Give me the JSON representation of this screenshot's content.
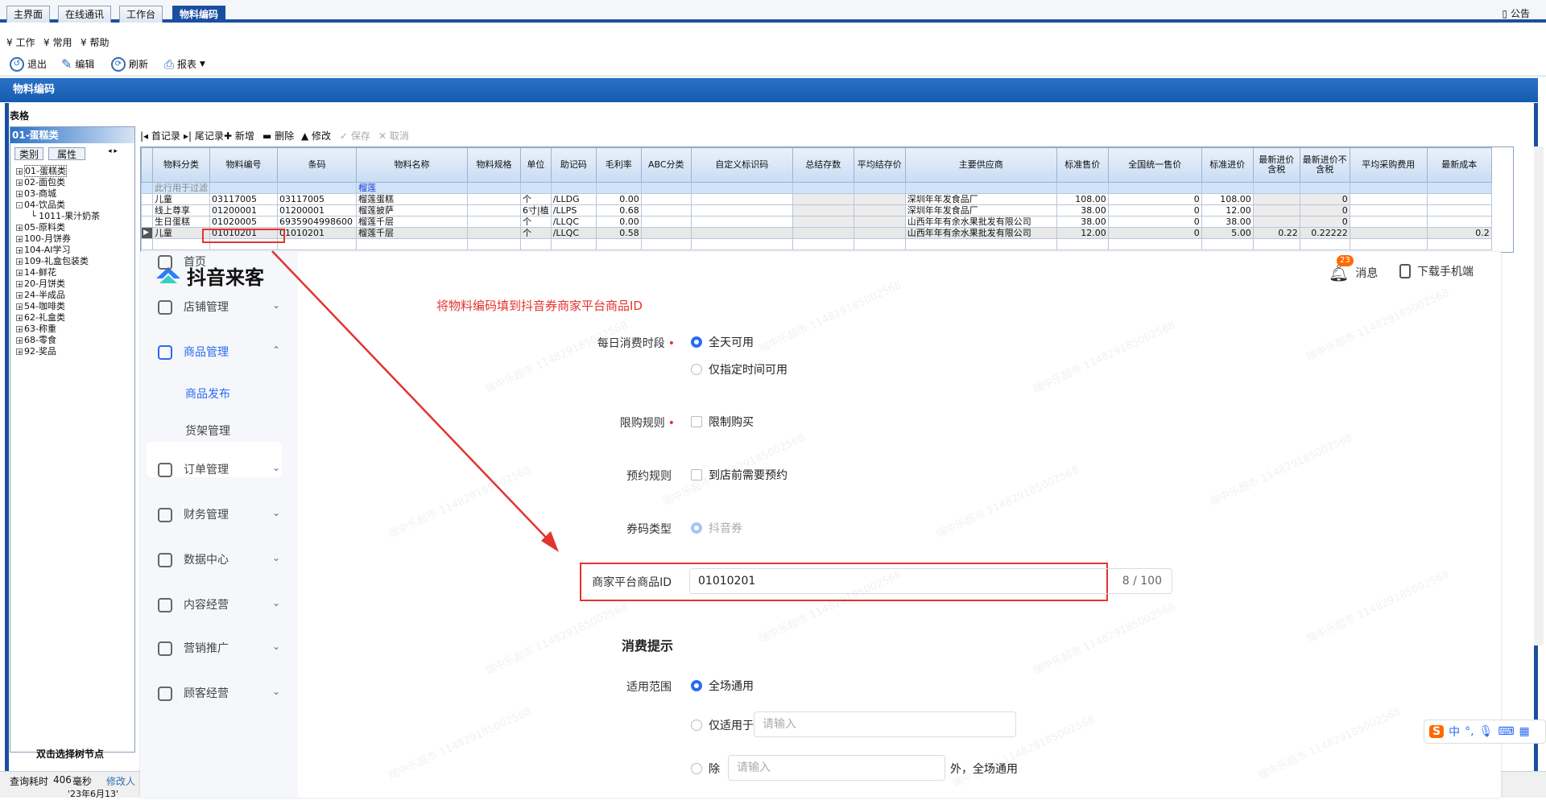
{
  "top_tabs": [
    "主界面",
    "在线通讯",
    "工作台",
    "物料编码"
  ],
  "notice_label": "公告",
  "menu": [
    "工作",
    "常用",
    "帮助"
  ],
  "toolbar": {
    "exit": "退出",
    "edit": "编辑",
    "refresh": "刷新",
    "report": "报表"
  },
  "module_title": "物料编码",
  "table_label": "表格",
  "tree": {
    "header": "01-蛋糕类",
    "tabs": [
      "类别",
      "属性"
    ],
    "items": [
      {
        "label": "01-蛋糕类",
        "indent": 0,
        "expander": "+"
      },
      {
        "label": "02-面包类",
        "indent": 0,
        "expander": "+"
      },
      {
        "label": "03-商城",
        "indent": 0,
        "expander": "+"
      },
      {
        "label": "04-饮品类",
        "indent": 0,
        "expander": "-"
      },
      {
        "label": "1011-果汁奶茶",
        "indent": 1,
        "expander": ""
      },
      {
        "label": "05-原料类",
        "indent": 0,
        "expander": "+"
      },
      {
        "label": "100-月饼券",
        "indent": 0,
        "expander": "+"
      },
      {
        "label": "104-AI学习",
        "indent": 0,
        "expander": "+"
      },
      {
        "label": "109-礼盒包装类",
        "indent": 0,
        "expander": "+"
      },
      {
        "label": "14-鲜花",
        "indent": 0,
        "expander": "+"
      },
      {
        "label": "20-月饼类",
        "indent": 0,
        "expander": "+"
      },
      {
        "label": "24-半成品",
        "indent": 0,
        "expander": "+"
      },
      {
        "label": "54-咖啡类",
        "indent": 0,
        "expander": "+"
      },
      {
        "label": "62-礼盒类",
        "indent": 0,
        "expander": "+"
      },
      {
        "label": "63-称重",
        "indent": 0,
        "expander": "+"
      },
      {
        "label": "68-零食",
        "indent": 0,
        "expander": "+"
      },
      {
        "label": "92-奖品",
        "indent": 0,
        "expander": "+"
      }
    ],
    "footer": "双击选择树节点"
  },
  "grid_tools": [
    "首记录",
    "尾记录",
    "新增",
    "删除",
    "修改",
    "保存",
    "取消"
  ],
  "grid": {
    "columns": [
      "物料分类",
      "物料编号",
      "条码",
      "物料名称",
      "物料规格",
      "单位",
      "助记码",
      "毛利率",
      "ABC分类",
      "自定义标识码",
      "总结存数",
      "平均结存价",
      "主要供应商",
      "标准售价",
      "全国统一售价",
      "标准进价",
      "最新进价含税",
      "最新进价不含税",
      "平均采购费用",
      "最新成本"
    ],
    "filter_row": [
      "此行用于过滤",
      "",
      "",
      "榴莲"
    ],
    "rows": [
      [
        "儿童",
        "03117005",
        "03117005",
        "榴莲蛋糕",
        "",
        "个",
        "/LLDG",
        "0.00",
        "",
        "",
        "",
        "",
        "深圳年年发食品厂",
        "108.00",
        "0",
        "108.00",
        "",
        "0",
        "",
        ""
      ],
      [
        "线上尊享",
        "01200001",
        "01200001",
        "榴莲披萨",
        "",
        "6寸|植",
        "/LLPS",
        "0.68",
        "",
        "",
        "",
        "",
        "深圳年年发食品厂",
        "38.00",
        "0",
        "12.00",
        "",
        "0",
        "",
        ""
      ],
      [
        "生日蛋糕",
        "01020005",
        "6935904998600",
        "榴莲千层",
        "",
        "个",
        "/LLQC",
        "0.00",
        "",
        "",
        "",
        "",
        "山西年年有余水果批发有限公司",
        "38.00",
        "0",
        "38.00",
        "",
        "0",
        "",
        ""
      ],
      [
        "儿童",
        "01010201",
        "01010201",
        "榴莲千层",
        "",
        "个",
        "/LLQC",
        "0.58",
        "",
        "",
        "",
        "",
        "山西年年有余水果批发有限公司",
        "12.00",
        "0",
        "5.00",
        "0.22",
        "0.22222",
        "",
        "0.2"
      ]
    ]
  },
  "status": {
    "query_time": "查询耗时",
    "query_ms": "406",
    "unit": "毫秒",
    "modifier": "修改人",
    "date_fragment": "'23年6月13'"
  },
  "overlay": {
    "brand": "抖音来客",
    "notifications_label": "消息",
    "notifications_count": "23",
    "download_label": "下载手机端",
    "nav": [
      {
        "label": "首页",
        "icon": "home-icon"
      },
      {
        "label": "店铺管理",
        "icon": "store-icon"
      },
      {
        "label": "商品管理",
        "icon": "goods-icon"
      },
      {
        "label": "商品发布",
        "icon": ""
      },
      {
        "label": "货架管理",
        "icon": ""
      },
      {
        "label": "订单管理",
        "icon": "order-icon"
      },
      {
        "label": "财务管理",
        "icon": "wallet-icon"
      },
      {
        "label": "数据中心",
        "icon": "chart-icon"
      },
      {
        "label": "内容经营",
        "icon": "megaphone-icon"
      },
      {
        "label": "营销推广",
        "icon": "location-icon"
      },
      {
        "label": "顾客经营",
        "icon": "user-icon"
      }
    ],
    "annotation": "将物料编码填到抖音券商家平台商品ID",
    "form": {
      "daily_time_label": "每日消费时段",
      "daily_time_opt1": "全天可用",
      "daily_time_opt2": "仅指定时间可用",
      "limit_label": "限购规则",
      "limit_opt": "限制购买",
      "booking_label": "预约规则",
      "booking_opt": "到店前需要预约",
      "code_type_label": "券码类型",
      "code_type_opt": "抖音券",
      "merchant_id_label": "商家平台商品ID",
      "merchant_id_value": "01010201",
      "merchant_id_count": "8 / 100",
      "section_title": "消费提示",
      "scope_label": "适用范围",
      "scope_opt1": "全场通用",
      "scope_opt2": "仅适用于",
      "scope_opt2_placeholder": "请输入",
      "scope_opt3": "除",
      "scope_opt3_placeholder": "请输入",
      "scope_opt3_suffix": "外，全场通用"
    },
    "watermark": "瑞中乐超市 1148291850025​68"
  },
  "ime": {
    "lang": "中"
  }
}
